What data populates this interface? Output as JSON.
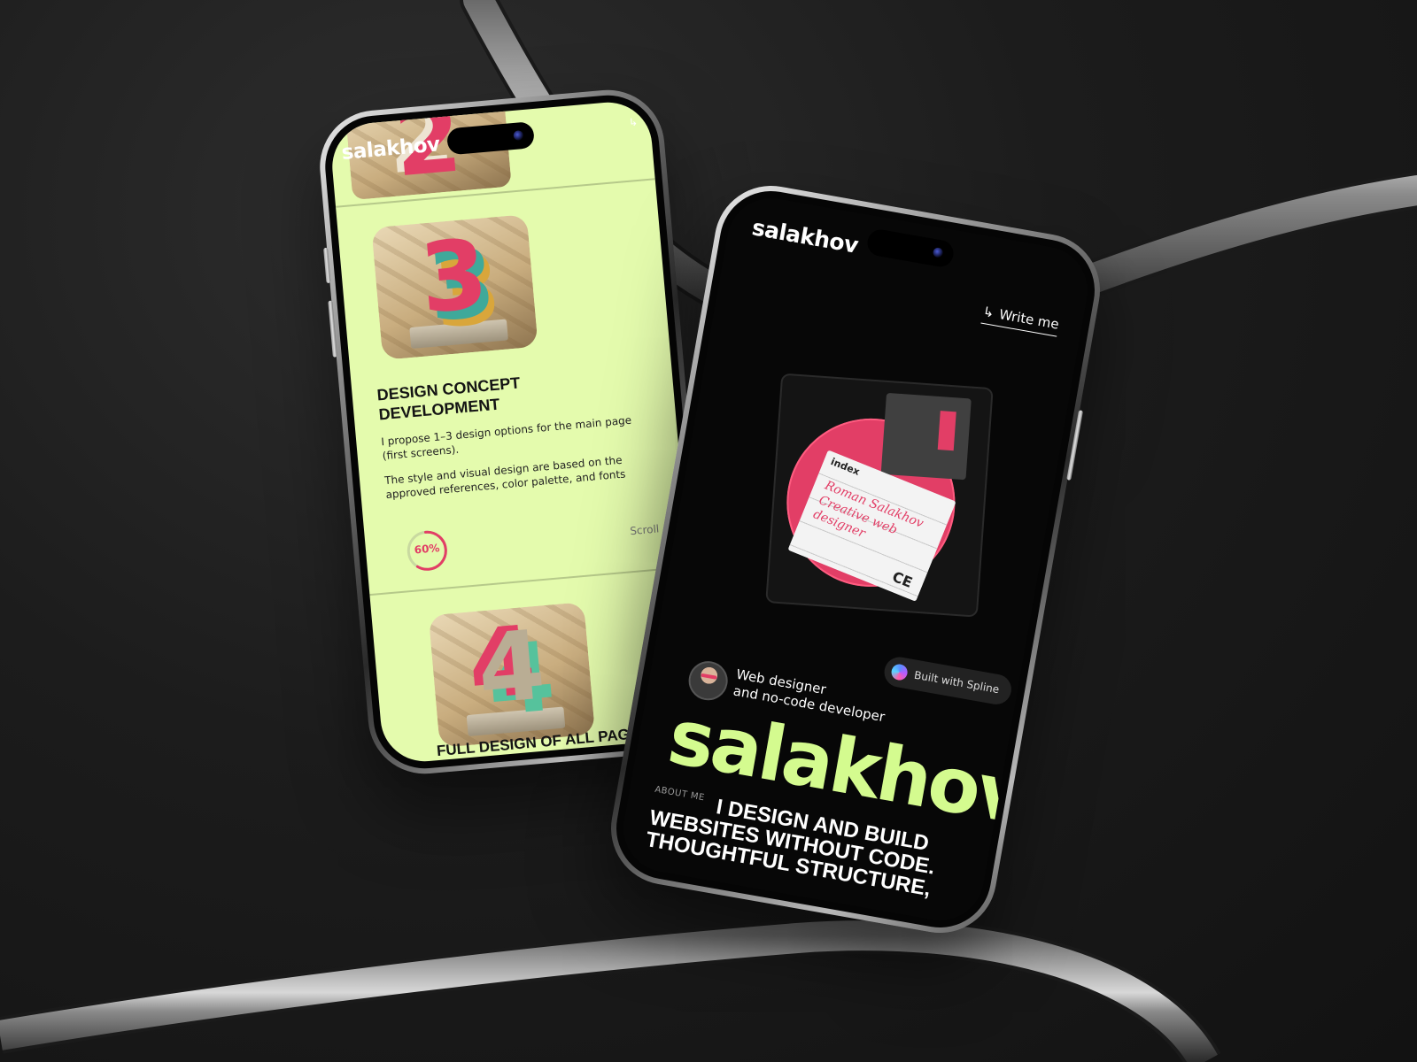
{
  "left_phone": {
    "logo": "salakhov",
    "write_link": "↳",
    "card_numbers": {
      "prev": "2",
      "current": "3",
      "next": "4"
    },
    "service": {
      "title": "DESIGN CONCEPT DEVELOPMENT",
      "paragraph_1": "I propose 1–3 design options for the main page (first screens).",
      "paragraph_2": "The style and visual design are based on the approved references, color palette, and fonts"
    },
    "progress": {
      "label": "60%",
      "value": 0.6
    },
    "scroll_label": "Scroll",
    "next_title": "FULL DESIGN OF ALL PAGES"
  },
  "right_phone": {
    "logo": "salakhov",
    "write_me": "Write me",
    "write_icon": "↳",
    "disk_label": {
      "index": "index",
      "handwriting": "Roman Salakhov Creative web designer",
      "mark": "CE"
    },
    "spline_badge": "Built with Spline",
    "role_line_1": "Web designer",
    "role_line_2": "and no-code developer",
    "big_logo": "salakhov",
    "about_tag": "ABOUT ME",
    "about_text": "I DESIGN AND BUILD WEBSITES WITHOUT CODE. THOUGHTFUL STRUCTURE,"
  },
  "colors": {
    "lime": "#e4fbad",
    "accent_pink": "#e23e66",
    "big_logo_green": "#d4fb8f",
    "dark": "#070707"
  }
}
